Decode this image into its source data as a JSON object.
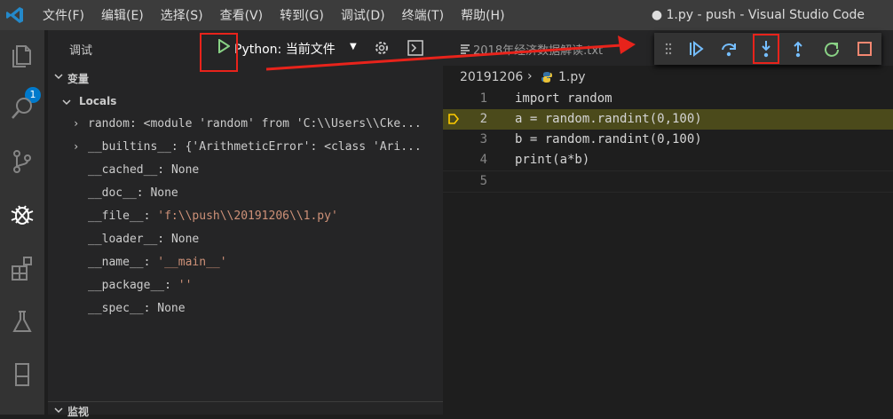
{
  "app": {
    "window_title": "● 1.py - push - Visual Studio Code"
  },
  "menu": [
    "文件(F)",
    "编辑(E)",
    "选择(S)",
    "查看(V)",
    "转到(G)",
    "调试(D)",
    "终端(T)",
    "帮助(H)"
  ],
  "activity_bar": {
    "explorer_badge": "1"
  },
  "debug": {
    "title": "调试",
    "config": "Python: 当前文件"
  },
  "sections": {
    "variables": "变量",
    "locals": "Locals",
    "watch": "监视"
  },
  "variables": [
    {
      "name": "random",
      "sep": ": ",
      "value": "<module 'random' from 'C:\\\\Users\\\\Cke...",
      "type": "expandable"
    },
    {
      "name": "__builtins__",
      "sep": ": ",
      "value": "{'ArithmeticError': <class 'Ari...",
      "type": "expandable"
    },
    {
      "name": "__cached__",
      "sep": ": ",
      "value": "None",
      "type": "none"
    },
    {
      "name": "__doc__",
      "sep": ": ",
      "value": "None",
      "type": "none"
    },
    {
      "name": "__file__",
      "sep": ": ",
      "value": "'f:\\\\push\\\\20191206\\\\1.py'",
      "type": "str"
    },
    {
      "name": "__loader__",
      "sep": ": ",
      "value": "None",
      "type": "none"
    },
    {
      "name": "__name__",
      "sep": ": ",
      "value": "'__main__'",
      "type": "str"
    },
    {
      "name": "__package__",
      "sep": ": ",
      "value": "''",
      "type": "str"
    },
    {
      "name": "__spec__",
      "sep": ": ",
      "value": "None",
      "type": "none"
    }
  ],
  "editor": {
    "tab_label": "2018年经济数据解读.txt",
    "breadcrumb_folder": "20191206",
    "breadcrumb_file": "1.py",
    "lines": [
      {
        "num": "1",
        "text": "import random"
      },
      {
        "num": "2",
        "text": "a = random.randint(0,100)"
      },
      {
        "num": "3",
        "text": "b = random.randint(0,100)"
      },
      {
        "num": "4",
        "text": "print(a*b)"
      },
      {
        "num": "5",
        "text": ""
      }
    ]
  },
  "debug_toolbar": [
    "continue-icon",
    "step-over-icon",
    "step-into-icon",
    "step-out-icon",
    "restart-icon",
    "stop-icon"
  ],
  "colors": {
    "accent_red": "#e8231b",
    "debug_blue": "#75beff",
    "stop_red": "#f48771",
    "restart_green": "#89d185"
  }
}
